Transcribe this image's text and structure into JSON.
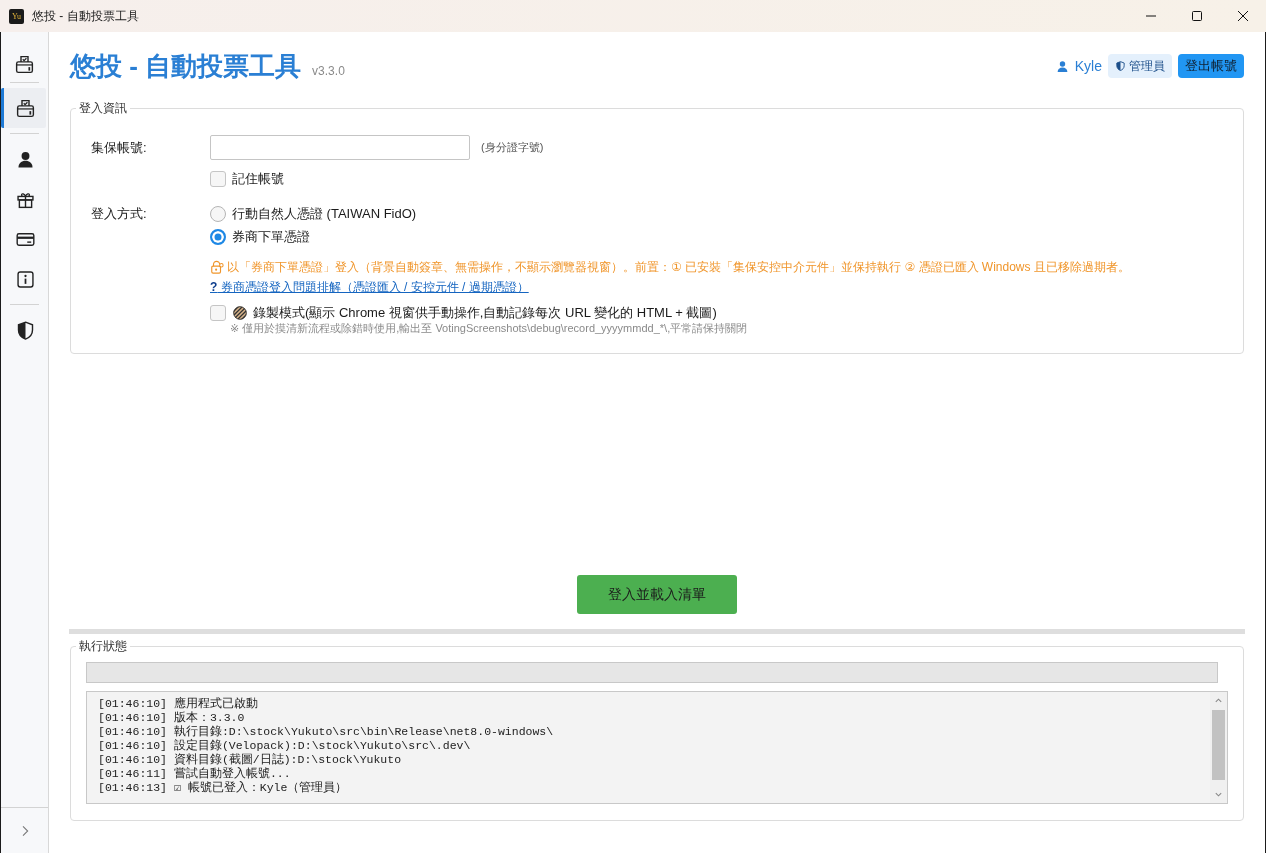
{
  "window": {
    "logo_text": "Yu",
    "title": "悠投 - 自動投票工具"
  },
  "sidebar": {
    "groups": [
      [
        {
          "selected": true
        }
      ],
      [
        {
          "selected": false
        },
        {
          "selected": false
        },
        {
          "selected": false
        },
        {
          "selected": false
        }
      ],
      [
        {
          "selected": false
        }
      ]
    ]
  },
  "header": {
    "title": "悠投 - 自動投票工具",
    "version": "v3.3.0",
    "user": "Kyle",
    "role": "管理員",
    "logout": "登出帳號"
  },
  "login": {
    "legend": "登入資訊",
    "account_label": "集保帳號:",
    "account_hint": "(身分證字號)",
    "remember": {
      "label": "記住帳號",
      "checked": false
    },
    "method_label": "登入方式:",
    "methods": [
      {
        "label": "行動自然人憑證 (TAIWAN FidO)",
        "selected": false
      },
      {
        "label": "券商下單憑證",
        "selected": true
      }
    ],
    "notice": "以「券商下單憑證」登入（背景自動簽章、無需操作，不顯示瀏覽器視窗）。前置：① 已安裝「集保安控中介元件」並保持執行 ② 憑證已匯入 Windows 且已移除過期者。",
    "help_link": "**?** 券商憑證登入問題排解（憑證匯入 / 安控元件 / 過期憑證）",
    "recording": {
      "label": "錄製模式(顯示 Chrome 視窗供手動操作,自動記錄每次 URL 變化的 HTML + 截圖)",
      "checked": false,
      "note": "※ 僅用於摸清新流程或除錯時使用,輸出至 VotingScreenshots\\debug\\record_yyyymmdd_*\\,平常請保持關閉"
    }
  },
  "submit": "登入並載入清單",
  "status": {
    "legend": "執行狀態",
    "progress": {
      "level": 0
    },
    "log": [
      "[01:46:10] 應用程式已啟動",
      "[01:46:10] 版本：3.3.0",
      "[01:46:10] 執行目錄:D:\\stock\\Yukuto\\src\\bin\\Release\\net8.0-windows\\",
      "[01:46:10] 設定目錄(Velopack):D:\\stock\\Yukuto\\src\\.dev\\",
      "[01:46:10] 資料目錄(截圖/日誌):D:\\stock\\Yukuto",
      "[01:46:11] 嘗試自動登入帳號...",
      "[01:46:13] ☑ 帳號已登入：Kyle（管理員）"
    ]
  }
}
